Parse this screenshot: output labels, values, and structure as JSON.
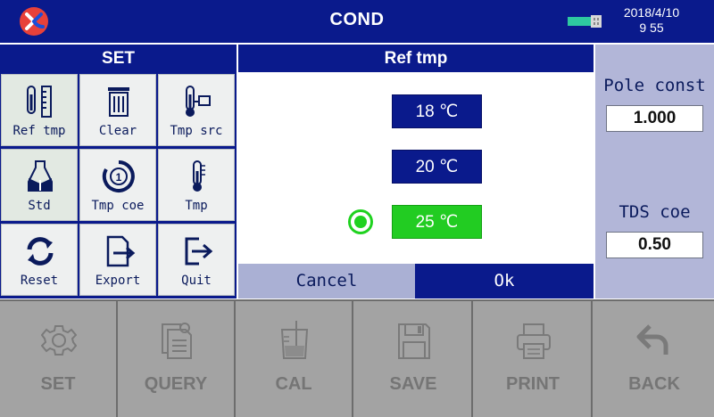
{
  "header": {
    "title": "COND",
    "date": "2018/4/10",
    "time": "9 55"
  },
  "set_panel": {
    "title": "SET",
    "tiles": [
      {
        "label": "Ref tmp",
        "icon": "thermometer-ruler-icon"
      },
      {
        "label": "Clear",
        "icon": "trash-icon"
      },
      {
        "label": "Tmp src",
        "icon": "thermometer-probe-icon"
      },
      {
        "label": "Std",
        "icon": "flask-book-icon"
      },
      {
        "label": "Tmp coe",
        "icon": "coefficient-dial-icon"
      },
      {
        "label": "Tmp",
        "icon": "thermometer-icon"
      },
      {
        "label": "Reset",
        "icon": "refresh-icon"
      },
      {
        "label": "Export",
        "icon": "export-icon"
      },
      {
        "label": "Quit",
        "icon": "exit-icon"
      }
    ]
  },
  "dialog": {
    "title": "Ref tmp",
    "options": [
      {
        "label": "18 ℃",
        "selected": false
      },
      {
        "label": "20 ℃",
        "selected": false
      },
      {
        "label": "25 ℃",
        "selected": true
      }
    ],
    "cancel_label": "Cancel",
    "ok_label": "Ok"
  },
  "right_panel": {
    "pole_const_label": "Pole const",
    "pole_const_value": "1.000",
    "tds_coe_label": "TDS coe",
    "tds_coe_value": "0.50"
  },
  "toolbar": {
    "items": [
      {
        "label": "SET",
        "icon": "gear-icon"
      },
      {
        "label": "QUERY",
        "icon": "document-query-icon"
      },
      {
        "label": "CAL",
        "icon": "beaker-icon"
      },
      {
        "label": "SAVE",
        "icon": "floppy-disk-icon"
      },
      {
        "label": "PRINT",
        "icon": "printer-icon"
      },
      {
        "label": "BACK",
        "icon": "back-arrow-icon"
      }
    ]
  },
  "colors": {
    "primary": "#0a1a8c",
    "selected_option": "#22cc22",
    "side_panel": "#b2b6d8",
    "toolbar": "#a3a3a3",
    "logo": "#e8413a"
  }
}
